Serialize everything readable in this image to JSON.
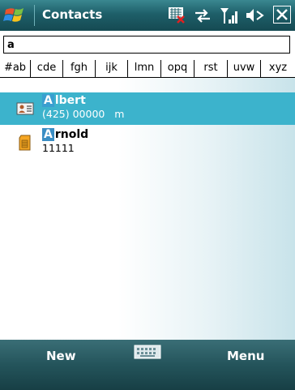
{
  "window": {
    "title": "Contacts"
  },
  "search": {
    "value": "a"
  },
  "alphabet": [
    "#ab",
    "cde",
    "fgh",
    "ijk",
    "lmn",
    "opq",
    "rst",
    "uvw",
    "xyz"
  ],
  "contacts": [
    {
      "highlight": "A",
      "name_rest": "lbert",
      "detail": "(425) 00000   m",
      "selected": true,
      "icon": "contact-card-icon"
    },
    {
      "highlight": "A",
      "name_rest": "rnold",
      "detail": "11111",
      "selected": false,
      "icon": "sim-card-icon"
    }
  ],
  "softkeys": {
    "left": "New",
    "right": "Menu"
  },
  "colors": {
    "titlebar": "#1e5f69",
    "selection": "#3cb3cc",
    "highlight": "#3a9fd0",
    "softbar": "#24545b"
  }
}
